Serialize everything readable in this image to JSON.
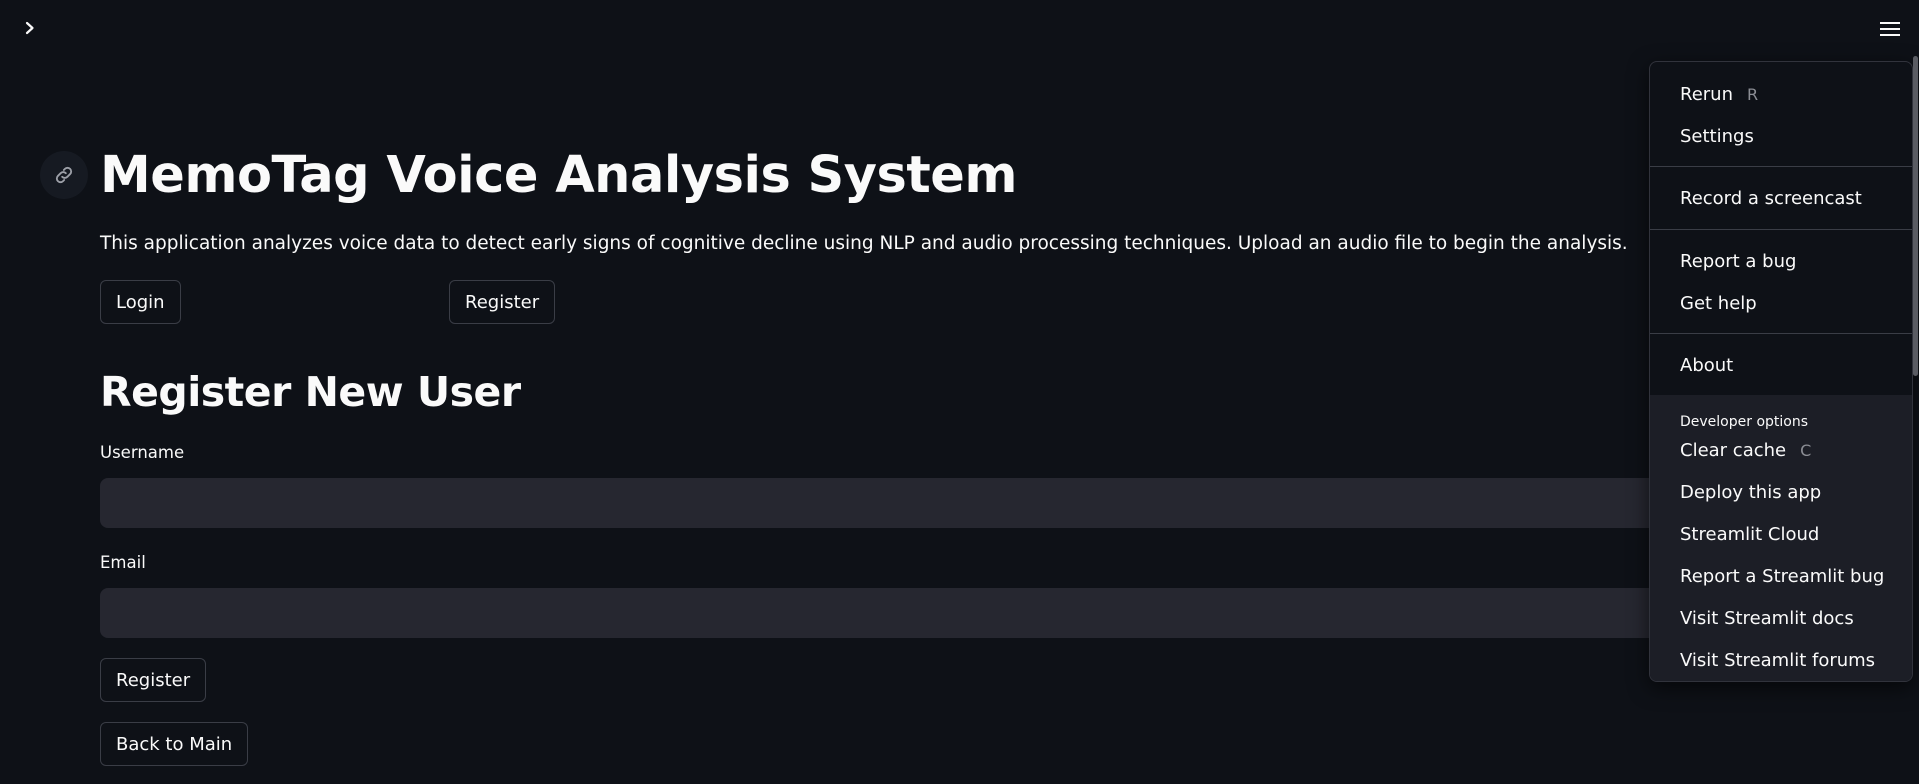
{
  "header": {
    "expand_icon": "chevron-right-icon",
    "menu_icon": "hamburger-menu-icon"
  },
  "main": {
    "anchor_icon": "link-icon",
    "title": "MemoTag Voice Analysis System",
    "intro": "This application analyzes voice data to detect early signs of cognitive decline using NLP and audio processing techniques. Upload an audio file to begin the analysis.",
    "login_label": "Login",
    "register_top_label": "Register",
    "register_heading": "Register New User",
    "username_label": "Username",
    "username_value": "",
    "email_label": "Email",
    "email_value": "",
    "register_submit_label": "Register",
    "back_label": "Back to Main"
  },
  "menu": {
    "rerun": {
      "label": "Rerun",
      "shortcut": "R"
    },
    "settings": "Settings",
    "record_screencast": "Record a screencast",
    "report_bug": "Report a bug",
    "get_help": "Get help",
    "about": "About",
    "developer_options": {
      "header": "Developer options",
      "clear_cache": {
        "label": "Clear cache",
        "shortcut": "C"
      },
      "deploy": "Deploy this app",
      "streamlit_cloud": "Streamlit Cloud",
      "report_streamlit_bug": "Report a Streamlit bug",
      "visit_docs": "Visit Streamlit docs",
      "visit_forums": "Visit Streamlit forums"
    }
  },
  "colors": {
    "background": "#0e1117",
    "input_background": "#262730",
    "dev_section_background": "#1c1e26",
    "text": "#fafafa",
    "muted": "#8b8d94"
  }
}
